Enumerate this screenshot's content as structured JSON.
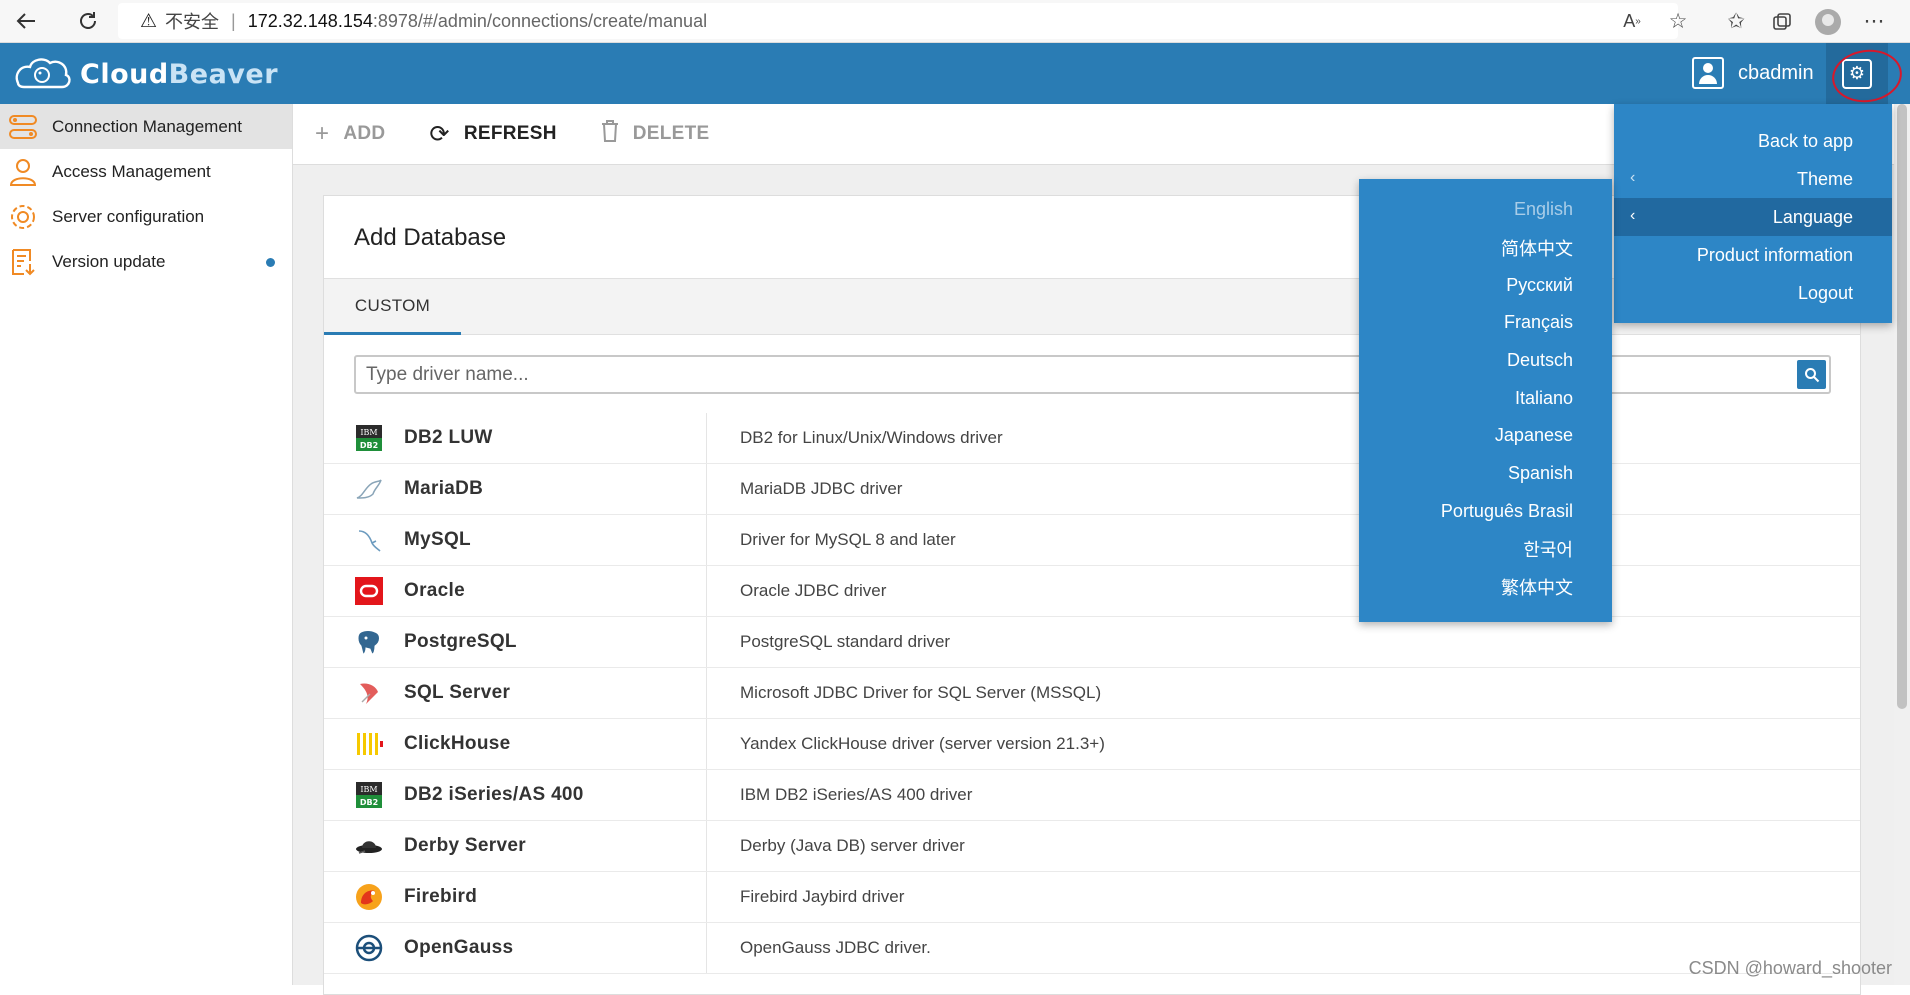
{
  "browser": {
    "insecure_label": "不安全",
    "separator": "|",
    "host": "172.32.148.154",
    "path": ":8978/#/admin/connections/create/manual"
  },
  "header": {
    "logo_part1": "Cloud",
    "logo_part2": "Beaver",
    "username": "cbadmin"
  },
  "sidebar": {
    "items": [
      {
        "label": "Connection Management",
        "icon": "connection-icon"
      },
      {
        "label": "Access Management",
        "icon": "user-icon"
      },
      {
        "label": "Server configuration",
        "icon": "gear-icon"
      },
      {
        "label": "Version update",
        "icon": "update-icon"
      }
    ]
  },
  "toolbar": {
    "add_label": "ADD",
    "refresh_label": "REFRESH",
    "delete_label": "DELETE"
  },
  "main": {
    "title": "Add Database",
    "tab_custom": "CUSTOM",
    "search_placeholder": "Type driver name...",
    "drivers": [
      {
        "name": "DB2 LUW",
        "desc": "DB2 for Linux/Unix/Windows driver",
        "icon": "db2-icon"
      },
      {
        "name": "MariaDB",
        "desc": "MariaDB JDBC driver",
        "icon": "mariadb-icon"
      },
      {
        "name": "MySQL",
        "desc": "Driver for MySQL 8 and later",
        "icon": "mysql-icon"
      },
      {
        "name": "Oracle",
        "desc": "Oracle JDBC driver",
        "icon": "oracle-icon"
      },
      {
        "name": "PostgreSQL",
        "desc": "PostgreSQL standard driver",
        "icon": "postgresql-icon"
      },
      {
        "name": "SQL Server",
        "desc": "Microsoft JDBC Driver for SQL Server (MSSQL)",
        "icon": "sqlserver-icon"
      },
      {
        "name": "ClickHouse",
        "desc": "Yandex ClickHouse driver (server version 21.3+)",
        "icon": "clickhouse-icon"
      },
      {
        "name": "DB2 iSeries/AS 400",
        "desc": "IBM DB2 iSeries/AS 400 driver",
        "icon": "db2-icon"
      },
      {
        "name": "Derby Server",
        "desc": "Derby (Java DB) server driver",
        "icon": "derby-icon"
      },
      {
        "name": "Firebird",
        "desc": "Firebird Jaybird driver",
        "icon": "firebird-icon"
      },
      {
        "name": "OpenGauss",
        "desc": "OpenGauss JDBC driver.",
        "icon": "opengauss-icon"
      }
    ]
  },
  "settings_menu": {
    "items": [
      {
        "label": "Back to app"
      },
      {
        "label": "Theme"
      },
      {
        "label": "Language"
      },
      {
        "label": "Product information"
      },
      {
        "label": "Logout"
      }
    ]
  },
  "language_menu": {
    "items": [
      "English",
      "简体中文",
      "Русский",
      "Français",
      "Deutsch",
      "Italiano",
      "Japanese",
      "Spanish",
      "Português Brasil",
      "한국어",
      "繁体中文"
    ]
  },
  "colors": {
    "brand": "#2a7cb4",
    "menu_bg": "#2d86c6",
    "menu_highlight": "#2169a0",
    "sidebar_icon": "#f08a24"
  },
  "watermark": "CSDN @howard_shooter"
}
